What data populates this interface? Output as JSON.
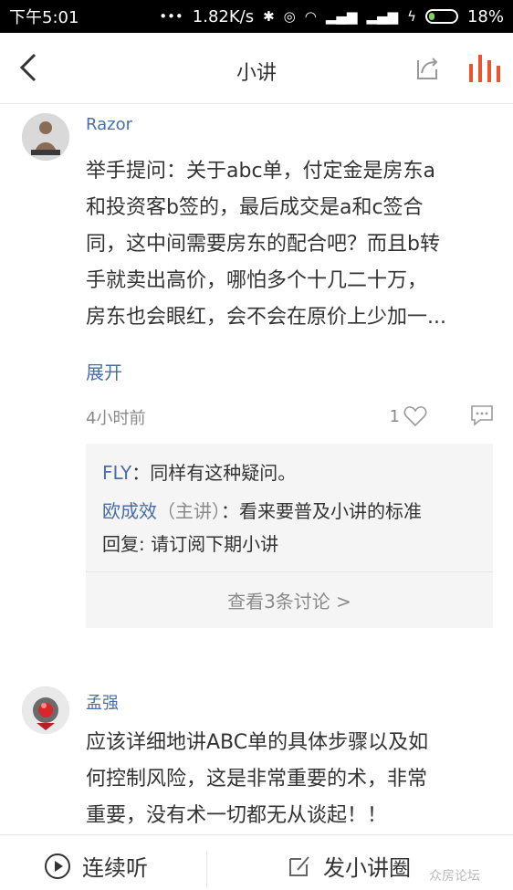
{
  "statusbar": {
    "time": "下午5:01",
    "net_speed": "1.82K/s",
    "battery_percent": "18%"
  },
  "nav": {
    "title": "小讲"
  },
  "comments": [
    {
      "author": "Razor",
      "body_lines": [
        "举手提问：关于abc单，付定金是房东a",
        "和投资客b签的，最后成交是a和c签合",
        "同，这中间需要房东的配合吧？而且b转",
        "手就卖出高价，哪怕多个十几二十万，",
        "房东也会眼红，会不会在原价上少加一..."
      ],
      "expand_label": "展开",
      "time": "4小时前",
      "likes": "1",
      "replies": [
        {
          "name": "FLY",
          "sep": "：",
          "text": "同样有这种疑问。"
        },
        {
          "name": "欧成效",
          "role": "（主讲）",
          "sep": "：",
          "text": "看来要普及小讲的标准"
        },
        {
          "text": "回复: 请订阅下期小讲"
        }
      ],
      "more_label": "查看3条讨论 >"
    },
    {
      "author": "孟强",
      "body_lines": [
        "应该详细地讲ABC单的具体步骤以及如",
        "何控制风险，这是非常重要的术，非常",
        "重要，没有术一切都无从谈起！！"
      ]
    }
  ],
  "bottom": {
    "continuous_label": "连续听",
    "post_label": "发小讲圈"
  },
  "watermark": "众房论坛"
}
